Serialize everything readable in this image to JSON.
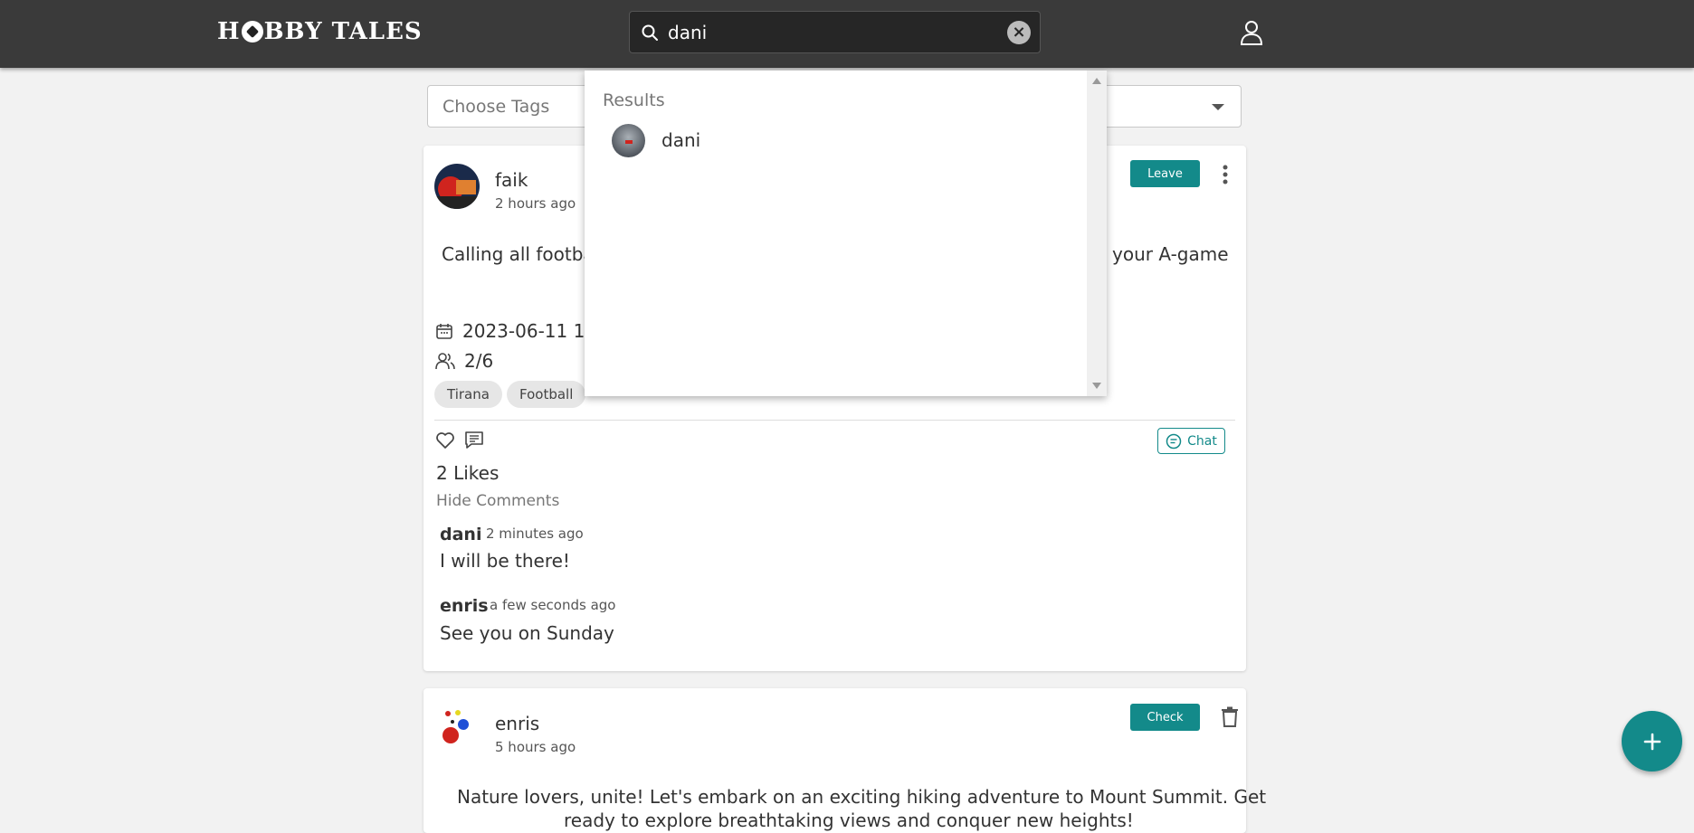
{
  "header": {
    "logo_part1": "H",
    "logo_part2": "BBY TALES",
    "search_value": "dani"
  },
  "filters": {
    "tags_placeholder": "Choose Tags"
  },
  "search_results": {
    "heading": "Results",
    "items": [
      {
        "name": "dani"
      }
    ]
  },
  "posts": [
    {
      "author": "faik",
      "time": "2 hours ago",
      "action_label": "Leave",
      "text_left": "Calling all footba",
      "text_right": "your A-game",
      "date": "2023-06-11 18:0",
      "participants": "2/6",
      "tags": [
        "Tirana",
        "Football"
      ],
      "chat_label": "Chat",
      "likes": "2 Likes",
      "toggle_comments": "Hide Comments",
      "comments": [
        {
          "author": "dani",
          "time": "2 minutes ago",
          "text": "I will be there!"
        },
        {
          "author": "enris",
          "time": "a few seconds ago",
          "text": "See you on Sunday"
        }
      ]
    },
    {
      "author": "enris",
      "time": "5 hours ago",
      "action_label": "Check",
      "text_line1": "Nature lovers, unite! Let's embark on an exciting hiking adventure to Mount Summit. Get",
      "text_line2": "ready to explore breathtaking views and conquer new heights!"
    }
  ],
  "colors": {
    "topbar": "#3a3a3a",
    "accent": "#138a8a",
    "background": "#f2f2f2"
  }
}
